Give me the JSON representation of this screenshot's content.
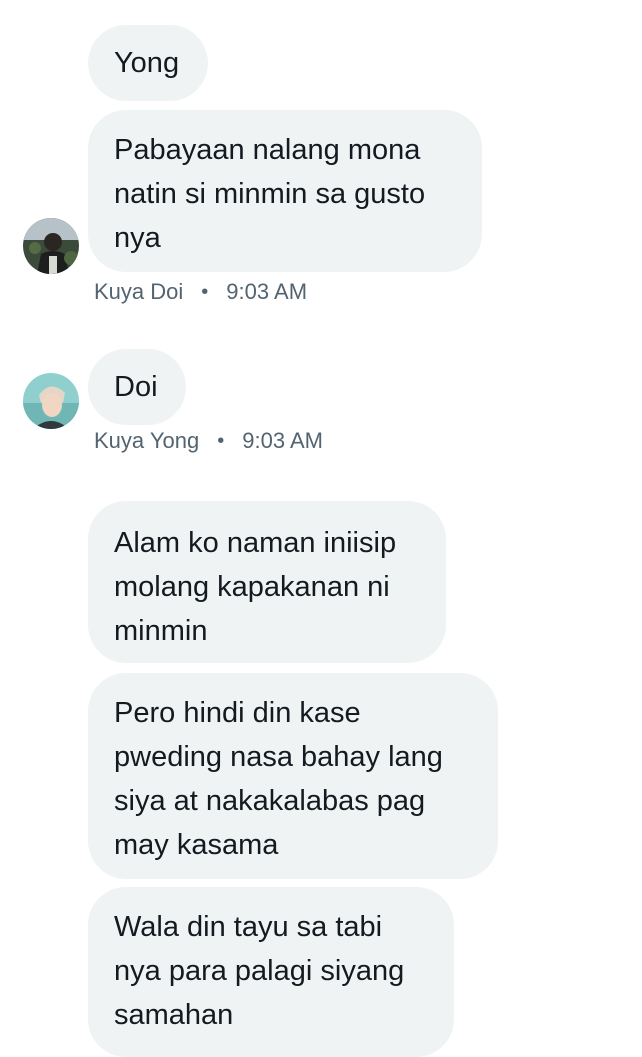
{
  "messages": [
    {
      "text": "Yong"
    },
    {
      "text": "Pabayaan nalang mona\nnatin si minmin sa gusto\nnya"
    },
    {
      "text": "Doi"
    },
    {
      "text": "Alam ko naman iniisip\nmolang kapakanan ni\nminmin"
    },
    {
      "text": "Pero hindi din kase\npweding nasa bahay lang\nsiya at nakakalabas pag\nmay kasama"
    },
    {
      "text": "Wala din tayu sa tabi\nnya para palagi siyang\nsamahan"
    }
  ],
  "meta": [
    {
      "sender": "Kuya Doi",
      "separator": "•",
      "time": "9:03 AM"
    },
    {
      "sender": "Kuya Yong",
      "separator": "•",
      "time": "9:03 AM"
    }
  ],
  "avatars": [
    {
      "icon": "avatar-kuya-doi",
      "user": "Kuya Doi"
    },
    {
      "icon": "avatar-kuya-yong",
      "user": "Kuya Yong"
    }
  ],
  "colors": {
    "bubble_bg": "#eff3f4",
    "text": "#0f1419",
    "meta_text": "#536471"
  }
}
